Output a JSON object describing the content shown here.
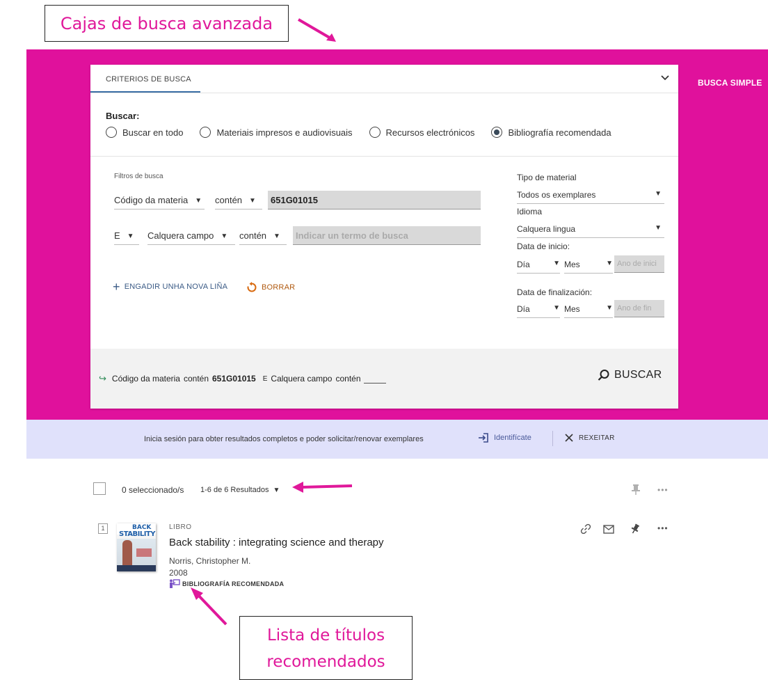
{
  "annotations": {
    "top_label": "Cajas de busca avanzada",
    "bottom_label": "Lista de títulos recomendados"
  },
  "header": {
    "busca_simple": "BUSCA SIMPLE"
  },
  "search_card": {
    "tab_label": "CRITERIOS DE BUSCA",
    "buscar_label": "Buscar:",
    "scopes": [
      {
        "label": "Buscar en todo",
        "selected": false
      },
      {
        "label": "Materiais impresos e audiovisuais",
        "selected": false
      },
      {
        "label": "Recursos electrónicos",
        "selected": false
      },
      {
        "label": "Bibliografía recomendada",
        "selected": true
      }
    ],
    "filters_label": "Filtros de busca",
    "row1": {
      "field": "Código da materia",
      "operator": "contén",
      "value": "651G01015"
    },
    "row2": {
      "boolean": "E",
      "field": "Calquera campo",
      "operator": "contén",
      "placeholder": "Indicar un termo de busca"
    },
    "add_line": "ENGADIR UNHA NOVA LIÑA",
    "clear": "BORRAR",
    "material_type": {
      "label": "Tipo de material",
      "value": "Todos os exemplares"
    },
    "language": {
      "label": "Idioma",
      "value": "Calquera lingua"
    },
    "start_date": {
      "label": "Data de inicio:",
      "day": "Día",
      "month": "Mes",
      "year_placeholder": "Ano de inici"
    },
    "end_date": {
      "label": "Data de finalización:",
      "day": "Día",
      "month": "Mes",
      "year_placeholder": "Ano de fin"
    },
    "query_summary": {
      "field1": "Código da materia",
      "op1": "contén",
      "value1": "651G01015",
      "boolean": "E",
      "field2": "Calquera campo",
      "op2": "contén"
    },
    "search_button": "BUSCAR"
  },
  "login_strip": {
    "message": "Inicia sesión para obter resultados completos e poder solicitar/renovar exemplares",
    "identify": "Identifícate",
    "dismiss": "REXEITAR"
  },
  "results": {
    "selected_count": "0 seleccionado/s",
    "results_count": "1-6 de 6 Resultados",
    "items": [
      {
        "index": "1",
        "type": "LIBRO",
        "title": "Back stability : integrating science and therapy",
        "author": "Norris, Christopher M.",
        "year": "2008",
        "tag": "BIBLIOGRAFÍA RECOMENDADA",
        "cover_line1": "BACK",
        "cover_line2": "STABILITY"
      }
    ]
  },
  "colors": {
    "magenta": "#e0119c",
    "annotation_text": "#e0189a",
    "login_strip": "#e0e1fb",
    "link_blue": "#3a5a85"
  }
}
